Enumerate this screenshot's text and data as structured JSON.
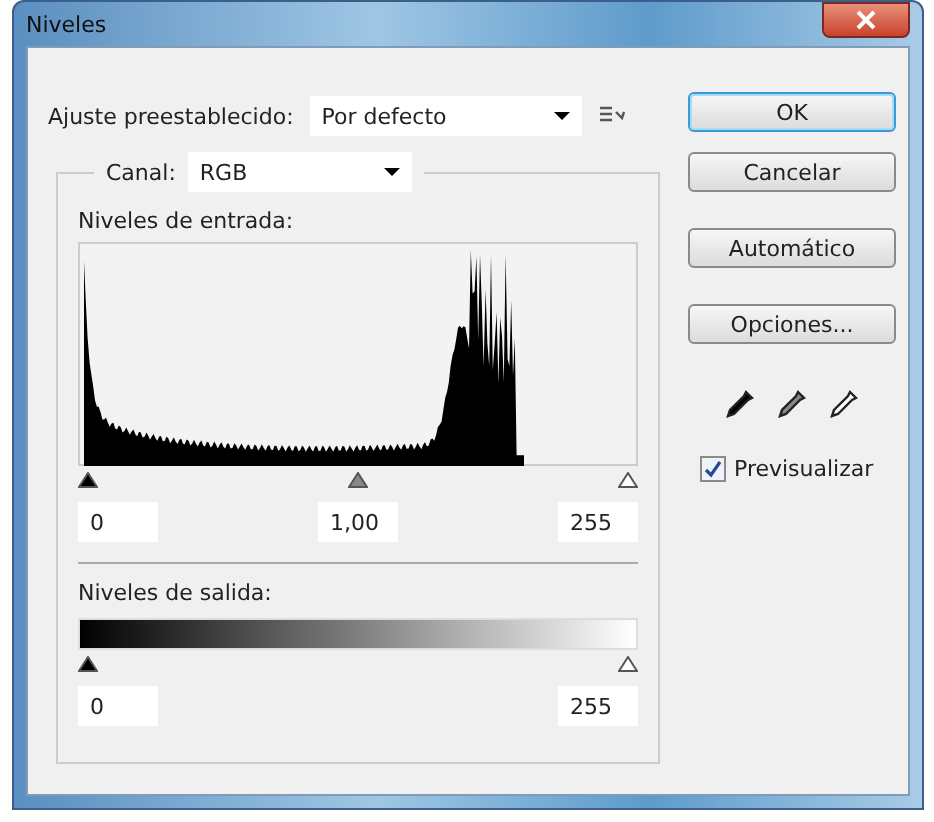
{
  "window": {
    "title": "Niveles"
  },
  "preset": {
    "label": "Ajuste preestablecido:",
    "value": "Por defecto"
  },
  "channel": {
    "label": "Canal:",
    "value": "RGB"
  },
  "input_levels": {
    "label": "Niveles de entrada:",
    "handles": [
      {
        "kind": "black"
      },
      {
        "kind": "gray"
      },
      {
        "kind": "white"
      }
    ],
    "fields": [
      "0",
      "1,00",
      "255"
    ]
  },
  "output_levels": {
    "label": "Niveles de salida:",
    "handles": [
      {
        "kind": "black"
      },
      {
        "kind": "white"
      }
    ],
    "fields": [
      "0",
      "255"
    ]
  },
  "buttons": [
    {
      "label": "OK",
      "default": true
    },
    {
      "label": "Cancelar",
      "default": false
    },
    {
      "label": "Automático",
      "default": false
    },
    {
      "label": "Opciones...",
      "default": false
    }
  ],
  "preview": {
    "label": "Previsualizar",
    "checked": true
  }
}
